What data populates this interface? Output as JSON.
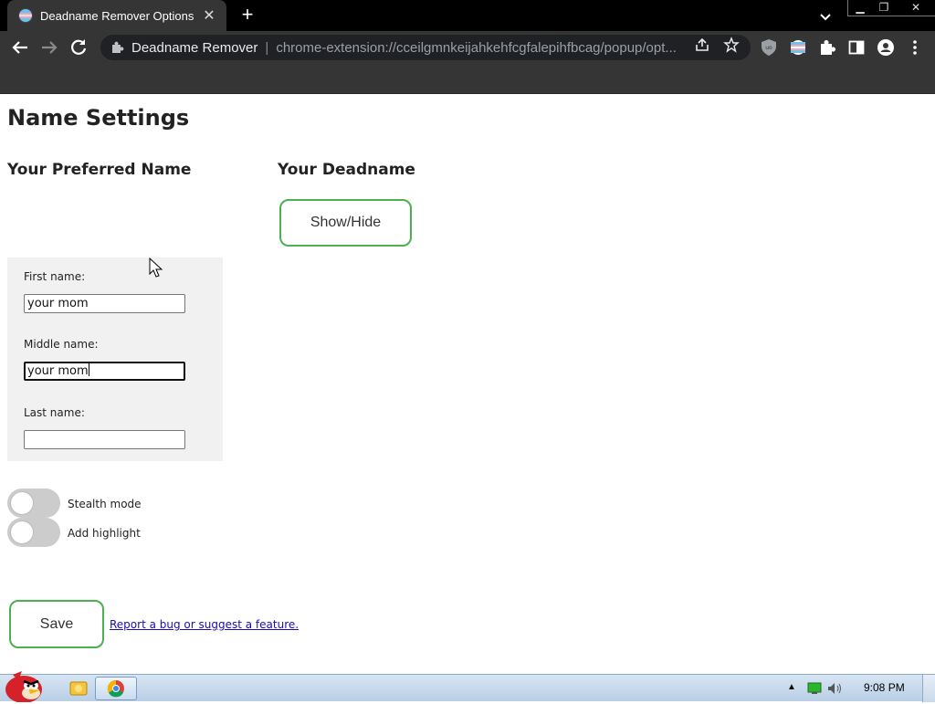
{
  "browser": {
    "tab_title": "Deadname Remover Options",
    "site_name": "Deadname Remover",
    "separator": "|",
    "url": "chrome-extension://cceilgmnkeijahkehfcgfalepihfbcag/popup/opt..."
  },
  "page": {
    "title": "Name Settings",
    "preferred_heading": "Your Preferred Name",
    "deadname_heading": "Your Deadname",
    "show_hide_label": "Show/Hide",
    "fields": {
      "first": {
        "label": "First name:",
        "value": "your mom"
      },
      "middle": {
        "label": "Middle name:",
        "value": "your mom"
      },
      "last": {
        "label": "Last name:",
        "value": ""
      }
    },
    "toggles": {
      "stealth": {
        "label": "Stealth mode",
        "on": false
      },
      "highlight": {
        "label": "Add highlight",
        "on": false
      }
    },
    "save_label": "Save",
    "bug_link": "Report a bug or suggest a feature."
  },
  "taskbar": {
    "clock": "9:08 PM"
  },
  "colors": {
    "accent_border": "#4caf50",
    "chrome_dark": "#353535",
    "taskbar": "#c7d9ee"
  }
}
